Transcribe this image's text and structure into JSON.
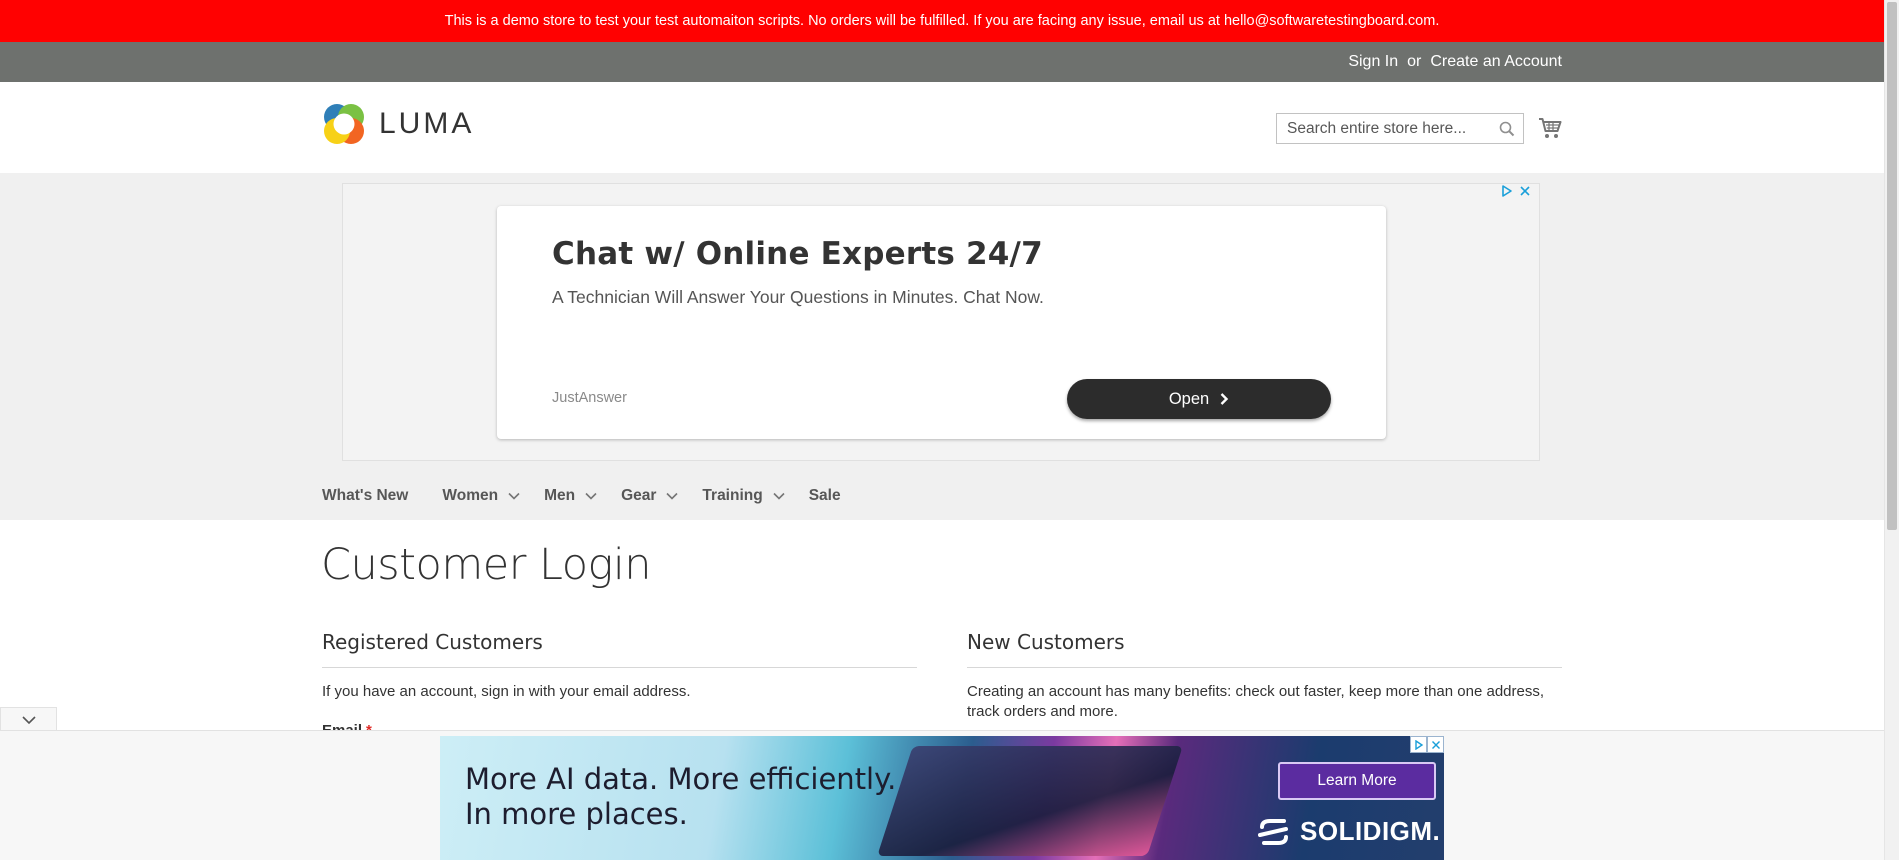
{
  "notice": {
    "text": "This is a demo store to test your test automaiton scripts. No orders will be fulfilled. If you are facing any issue, email us at hello@softwaretestingboard.com."
  },
  "top_links": {
    "sign_in": "Sign In",
    "or": "or",
    "create_account": "Create an Account"
  },
  "logo": {
    "text": "LUMA"
  },
  "search": {
    "placeholder": "Search entire store here..."
  },
  "ad": {
    "title": "Chat w/ Online Experts 24/7",
    "subtitle": "A Technician Will Answer Your Questions in Minutes. Chat Now.",
    "brand": "JustAnswer",
    "button": "Open"
  },
  "nav": {
    "items": [
      {
        "label": "What's New"
      },
      {
        "label": "Women"
      },
      {
        "label": "Men"
      },
      {
        "label": "Gear"
      },
      {
        "label": "Training"
      },
      {
        "label": "Sale"
      }
    ]
  },
  "page": {
    "title": "Customer Login",
    "registered": {
      "heading": "Registered Customers",
      "text": "If you have an account, sign in with your email address.",
      "email_label": "Email",
      "required_mark": "*"
    },
    "new_customers": {
      "heading": "New Customers",
      "text": "Creating an account has many benefits: check out faster, keep more than one address, track orders and more."
    }
  },
  "bottom_ad": {
    "headline_line1": "More AI data. More efficiently.",
    "headline_line2": "In more places.",
    "button": "Learn More",
    "brand": "SOLIDIGM."
  },
  "colors": {
    "notice_bg": "#ff0101",
    "topbar_bg": "#6e716e",
    "band_bg": "#f0f0f0",
    "required": "#e02b27"
  }
}
